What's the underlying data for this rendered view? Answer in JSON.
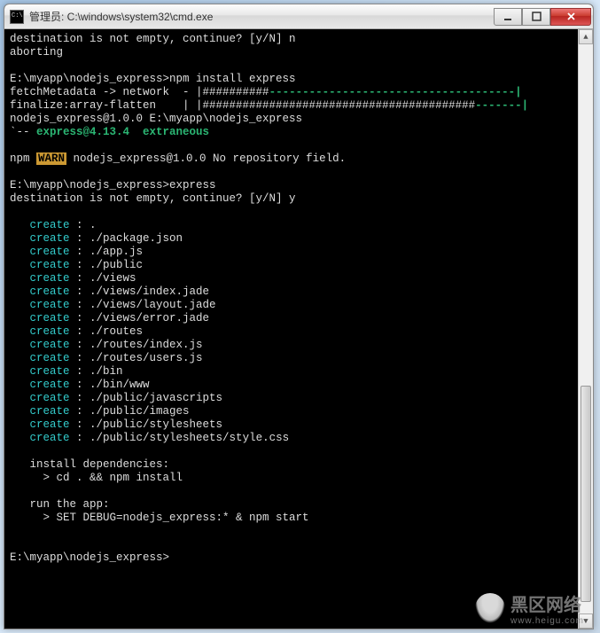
{
  "window": {
    "title": "管理员: C:\\windows\\system32\\cmd.exe"
  },
  "term": {
    "l1": "destination is not empty, continue? [y/N] n",
    "l2": "aborting",
    "l3": "",
    "prompt1": "E:\\myapp\\nodejs_express>",
    "cmd1": "npm install express",
    "fetch1": "fetchMetadata -> network  - |##########",
    "fetch1b": "-------------------------------------|",
    "final1": "finalize:array-flatten    | |#########################################",
    "final1b": "-------|",
    "pkg": "nodejs_express@1.0.0 E:\\myapp\\nodejs_express",
    "tree1a": "`-- ",
    "tree1b": "express@4.13.4",
    "tree1c": "  extraneous",
    "npm": "npm ",
    "warn": "WARN",
    "warnmsg": " nodejs_express@1.0.0 No repository field.",
    "cmd2": "express",
    "l4": "destination is not empty, continue? [y/N] y",
    "create": "create",
    "c1": " : .",
    "c2": " : ./package.json",
    "c3": " : ./app.js",
    "c4": " : ./public",
    "c5": " : ./views",
    "c6": " : ./views/index.jade",
    "c7": " : ./views/layout.jade",
    "c8": " : ./views/error.jade",
    "c9": " : ./routes",
    "c10": " : ./routes/index.js",
    "c11": " : ./routes/users.js",
    "c12": " : ./bin",
    "c13": " : ./bin/www",
    "c14": " : ./public/javascripts",
    "c15": " : ./public/images",
    "c16": " : ./public/stylesheets",
    "c17": " : ./public/stylesheets/style.css",
    "dep1": "   install dependencies:",
    "dep2": "     > cd . && npm install",
    "run1": "   run the app:",
    "run2": "     > SET DEBUG=nodejs_express:* & npm start",
    "prompt3": "E:\\myapp\\nodejs_express>"
  },
  "watermark": {
    "text": "黑区网络",
    "sub": "www.heigu.com"
  }
}
